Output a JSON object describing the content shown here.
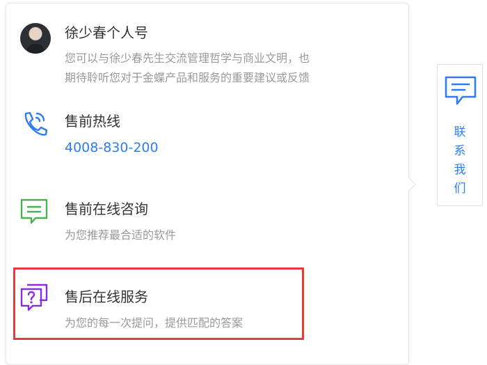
{
  "personal": {
    "title": "徐少春个人号",
    "desc_line1": "您可以与徐少春先生交流管理哲学与商业文明，也",
    "desc_line2": "期待聆听您对于金蝶产品和服务的重要建议或反馈"
  },
  "presales_hotline": {
    "title": "售前热线",
    "phone": "4008-830-200"
  },
  "presales_online": {
    "title": "售前在线咨询",
    "desc": "为您推荐最合适的软件"
  },
  "aftersales_online": {
    "title": "售后在线服务",
    "desc": "为您的每一次提问，提供匹配的答案"
  },
  "side_tab": {
    "label": "联系我们",
    "chars": [
      "联",
      "系",
      "我",
      "们"
    ]
  },
  "colors": {
    "blue": "#2d7cf6",
    "green": "#4caf50",
    "purple": "#8a2be2",
    "highlight": "#e33a3a"
  }
}
